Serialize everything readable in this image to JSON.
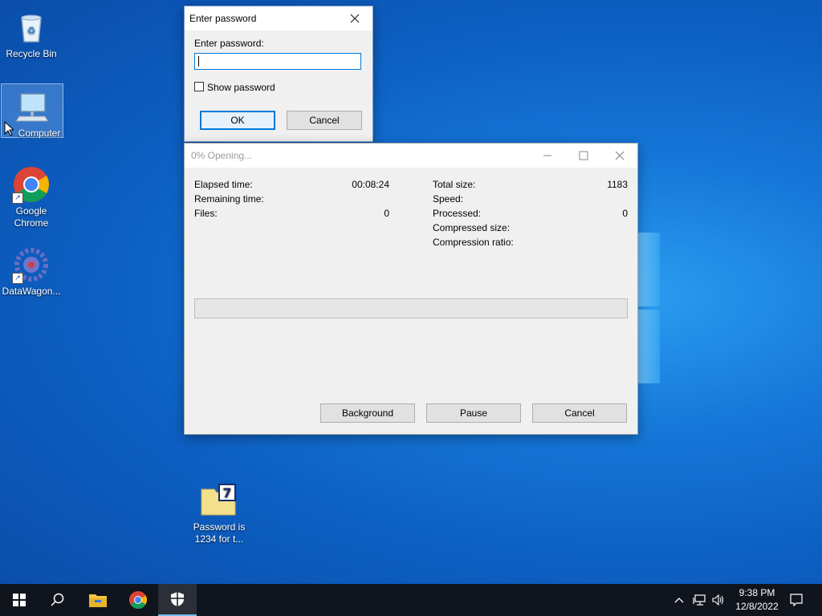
{
  "desktop": {
    "icons": [
      {
        "label": "Recycle Bin"
      },
      {
        "label": "Computer"
      },
      {
        "label": "Google\nChrome"
      },
      {
        "label": "DataWagon..."
      },
      {
        "label": "Password is\n1234 for t..."
      }
    ]
  },
  "password_dialog": {
    "title": "Enter password",
    "prompt": "Enter password:",
    "input_value": "",
    "show_password_label": "Show password",
    "show_password_checked": false,
    "ok_label": "OK",
    "cancel_label": "Cancel"
  },
  "progress_dialog": {
    "title": "0% Opening...",
    "progress_fraction": 0,
    "left": [
      {
        "label": "Elapsed time:",
        "value": "00:08:24"
      },
      {
        "label": "Remaining time:",
        "value": ""
      },
      {
        "label": "Files:",
        "value": "0"
      }
    ],
    "right": [
      {
        "label": "Total size:",
        "value": "1183"
      },
      {
        "label": "Speed:",
        "value": ""
      },
      {
        "label": "Processed:",
        "value": "0"
      },
      {
        "label": "Compressed size:",
        "value": ""
      },
      {
        "label": "Compression ratio:",
        "value": ""
      }
    ],
    "background_label": "Background",
    "pause_label": "Pause",
    "cancel_label": "Cancel"
  },
  "taskbar": {
    "time": "9:38 PM",
    "date": "12/8/2022",
    "icons": [
      "windows-start-icon",
      "search-icon",
      "file-explorer-icon",
      "chrome-icon",
      "security-shield-icon"
    ]
  },
  "colors": {
    "accent": "#0078d7",
    "taskbar": "#10141c",
    "desktop": "#0d5fc2"
  }
}
